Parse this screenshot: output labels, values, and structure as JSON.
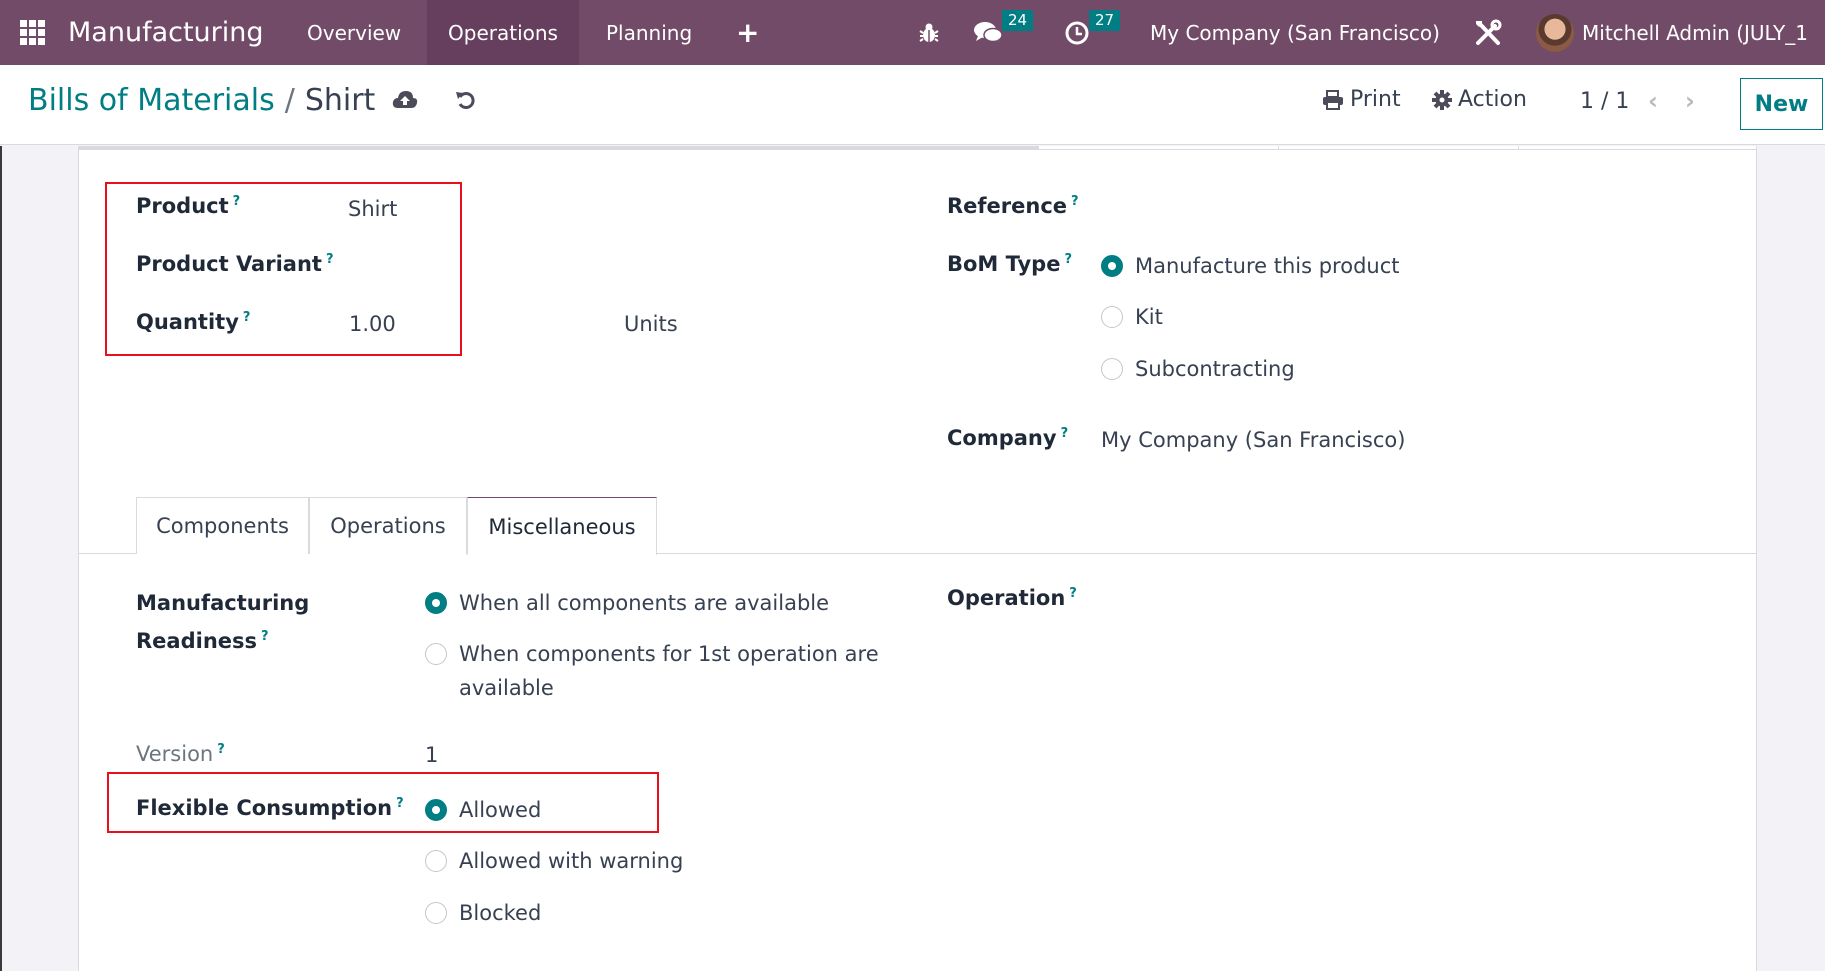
{
  "navbar": {
    "app_name": "Manufacturing",
    "menu": [
      "Overview",
      "Operations",
      "Planning"
    ],
    "active_menu": "Operations",
    "messages_count": "24",
    "activities_count": "27",
    "company": "My Company (San Francisco)",
    "user": "Mitchell Admin (JULY_1"
  },
  "control_panel": {
    "breadcrumb_parent": "Bills of Materials",
    "breadcrumb_separator": "/",
    "breadcrumb_current": "Shirt",
    "print_label": "Print",
    "action_label": "Action",
    "pager": "1 / 1",
    "new_label": "New"
  },
  "icons": {
    "apps": "grid-icon",
    "add": "plus-icon",
    "debug": "bug-icon",
    "messages": "chat-icon",
    "activities": "clock-icon",
    "settings": "tools-icon",
    "save": "cloud-upload-icon",
    "discard": "undo-icon",
    "print": "printer-icon",
    "action": "gear-icon",
    "prev": "chevron-left-icon",
    "next": "chevron-right-icon"
  },
  "form": {
    "product_label": "Product",
    "product_value": "Shirt",
    "variant_label": "Product Variant",
    "variant_value": "",
    "quantity_label": "Quantity",
    "quantity_value": "1.00",
    "uom_value": "Units",
    "reference_label": "Reference",
    "reference_value": "",
    "bom_type_label": "BoM Type",
    "bom_type_options": [
      "Manufacture this product",
      "Kit",
      "Subcontracting"
    ],
    "bom_type_selected": 0,
    "company_label": "Company",
    "company_value": "My Company (San Francisco)",
    "help_mark": "?"
  },
  "tabs": {
    "items": [
      "Components",
      "Operations",
      "Miscellaneous"
    ],
    "active": "Miscellaneous"
  },
  "misc": {
    "readiness_label_line1": "Manufacturing",
    "readiness_label_line2": "Readiness",
    "readiness_options": [
      "When all components are available",
      "When components for 1st operation are",
      "available"
    ],
    "readiness_selected": 0,
    "operation_label": "Operation",
    "version_label": "Version",
    "version_value": "1",
    "flexible_label": "Flexible Consumption",
    "flexible_options": [
      "Allowed",
      "Allowed with warning",
      "Blocked"
    ],
    "flexible_selected": 0
  },
  "colors": {
    "brand": "#714B67",
    "accent": "#017e84",
    "highlight_box": "#e8101a"
  }
}
